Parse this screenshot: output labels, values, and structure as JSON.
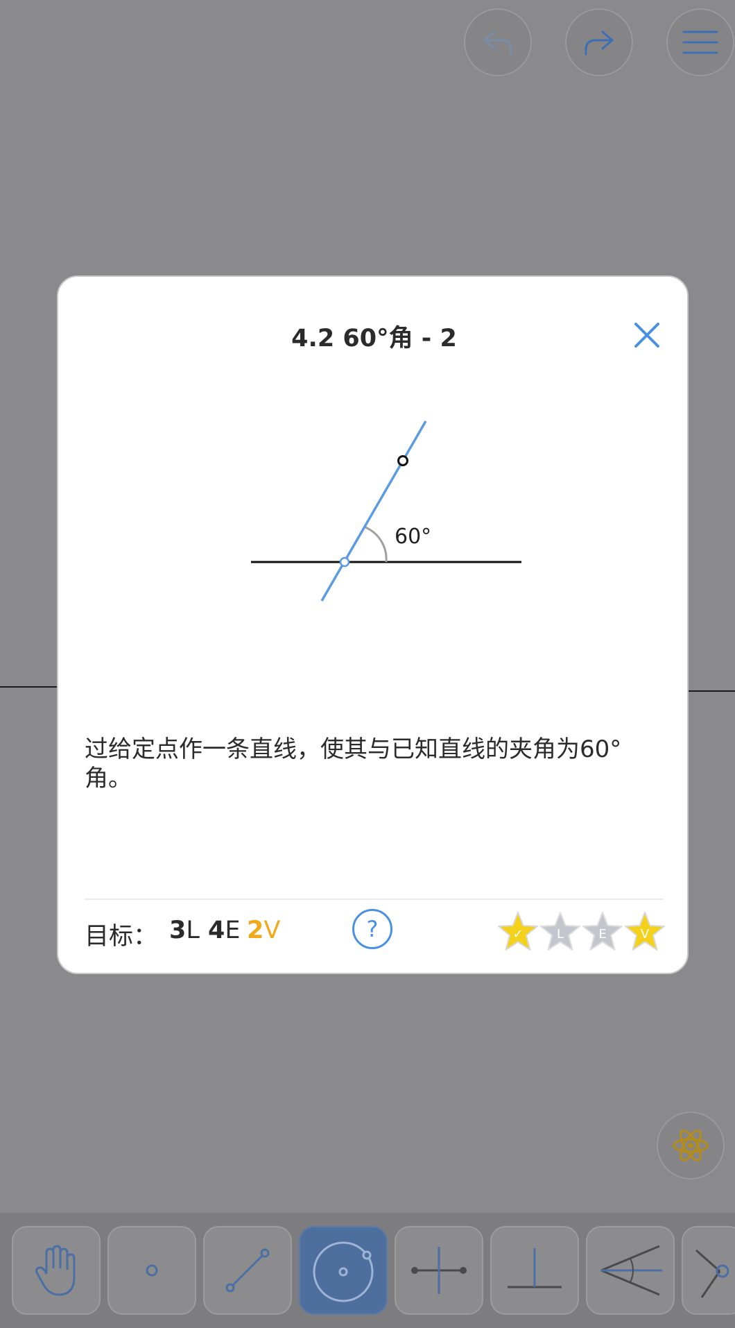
{
  "dialog": {
    "title": "4.2 60°角 - 2",
    "angle_label": "60°",
    "description": "过给定点作一条直线，使其与已知直线的夹角为60°角。",
    "goal_label": "目标：",
    "goals": [
      {
        "count": "3",
        "unit": "L"
      },
      {
        "count": "4",
        "unit": "E"
      },
      {
        "count": "2",
        "unit": "V"
      }
    ],
    "help_label": "?",
    "stars": [
      {
        "mark": "✓",
        "earned": true
      },
      {
        "mark": "L",
        "earned": false
      },
      {
        "mark": "E",
        "earned": false
      },
      {
        "mark": "V",
        "earned": true
      }
    ]
  },
  "colors": {
    "accent": "#4a90e2",
    "star_gold": "#f4d21c",
    "star_grey": "#c3c6cc",
    "goal_highlight": "#f0a91a"
  },
  "icons": {
    "top": [
      "undo-icon",
      "redo-icon",
      "menu-icon"
    ],
    "tools": [
      "hand-icon",
      "point-icon",
      "line-icon",
      "circle-icon",
      "perpendicular-bisector-icon",
      "perpendicular-icon",
      "angle-bisector-icon",
      "compass-icon"
    ],
    "hint": "atom-icon"
  }
}
